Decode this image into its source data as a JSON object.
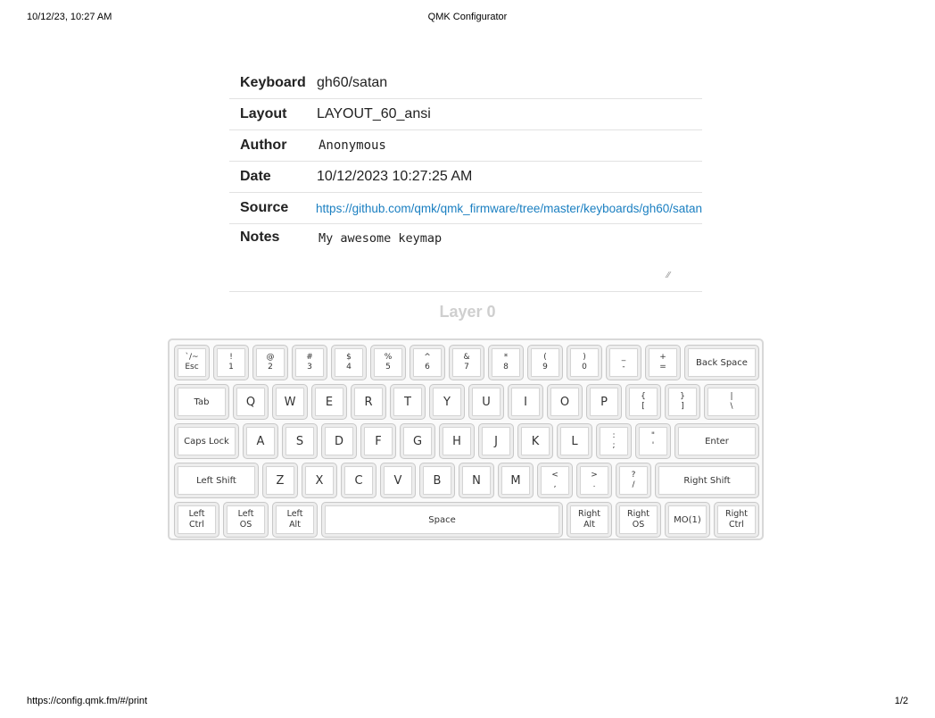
{
  "print": {
    "datetime": "10/12/23, 10:27 AM",
    "title": "QMK Configurator",
    "url": "https://config.qmk.fm/#/print",
    "page": "1/2"
  },
  "info": {
    "keyboard_label": "Keyboard",
    "keyboard_value": "gh60/satan",
    "layout_label": "Layout",
    "layout_value": "LAYOUT_60_ansi",
    "author_label": "Author",
    "author_value": "Anonymous",
    "date_label": "Date",
    "date_value": "10/12/2023 10:27:25 AM",
    "source_label": "Source",
    "source_value": "https://github.com/qmk/qmk_firmware/tree/master/keyboards/gh60/satan",
    "notes_label": "Notes",
    "notes_value": "My awesome keymap"
  },
  "layer_title": "Layer 0",
  "keys": {
    "grave": {
      "top": "`/~",
      "bottom": "Esc"
    },
    "k1": {
      "top": "!",
      "bottom": "1"
    },
    "k2": {
      "top": "@",
      "bottom": "2"
    },
    "k3": {
      "top": "#",
      "bottom": "3"
    },
    "k4": {
      "top": "$",
      "bottom": "4"
    },
    "k5": {
      "top": "%",
      "bottom": "5"
    },
    "k6": {
      "top": "^",
      "bottom": "6"
    },
    "k7": {
      "top": "&",
      "bottom": "7"
    },
    "k8": {
      "top": "*",
      "bottom": "8"
    },
    "k9": {
      "top": "(",
      "bottom": "9"
    },
    "k0": {
      "top": ")",
      "bottom": "0"
    },
    "minus": {
      "top": "_",
      "bottom": "-"
    },
    "equal": {
      "top": "+",
      "bottom": "="
    },
    "backspace": "Back Space",
    "tab": "Tab",
    "q": "Q",
    "w": "W",
    "e": "E",
    "r": "R",
    "t": "T",
    "y": "Y",
    "u": "U",
    "i": "I",
    "o": "O",
    "p": "P",
    "lbracket": {
      "top": "{",
      "bottom": "["
    },
    "rbracket": {
      "top": "}",
      "bottom": "]"
    },
    "backslash": {
      "top": "|",
      "bottom": "\\"
    },
    "capslock": "Caps Lock",
    "a": "A",
    "s": "S",
    "d": "D",
    "f": "F",
    "g": "G",
    "h": "H",
    "j": "J",
    "k": "K",
    "l": "L",
    "semicolon": {
      "top": ":",
      "bottom": ";"
    },
    "quote": {
      "top": "\"",
      "bottom": "'"
    },
    "enter": "Enter",
    "lshift": "Left Shift",
    "z": "Z",
    "x": "X",
    "c": "C",
    "v": "V",
    "b": "B",
    "n": "N",
    "m": "M",
    "comma": {
      "top": "<",
      "bottom": ","
    },
    "period": {
      "top": ">",
      "bottom": "."
    },
    "slash": {
      "top": "?",
      "bottom": "/"
    },
    "rshift": "Right Shift",
    "lctrl": {
      "top": "Left",
      "bottom": "Ctrl"
    },
    "los": {
      "top": "Left",
      "bottom": "OS"
    },
    "lalt": {
      "top": "Left",
      "bottom": "Alt"
    },
    "space": "Space",
    "ralt": {
      "top": "Right",
      "bottom": "Alt"
    },
    "ros": {
      "top": "Right",
      "bottom": "OS"
    },
    "mo1": "MO(1)",
    "rctrl": {
      "top": "Right",
      "bottom": "Ctrl"
    }
  }
}
